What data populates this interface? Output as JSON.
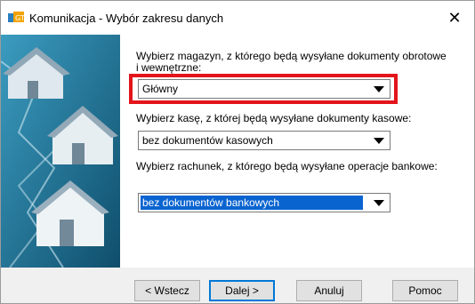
{
  "window": {
    "title": "Komunikacja - Wybór zakresu danych",
    "close_glyph": "✕"
  },
  "fields": [
    {
      "label": "Wybierz magazyn, z którego będą wysyłane dokumenty obrotowe i wewnętrzne:",
      "value": "Główny"
    },
    {
      "label": "Wybierz kasę, z której będą wysyłane dokumenty kasowe:",
      "value": "bez dokumentów kasowych"
    },
    {
      "label": "Wybierz rachunek, z którego będą wysyłane operacje bankowe:",
      "value": "bez dokumentów bankowych"
    }
  ],
  "buttons": {
    "back": "< Wstecz",
    "next": "Dalej >",
    "cancel": "Anuluj",
    "help": "Pomoc"
  },
  "colors": {
    "highlight": "#e3141b",
    "selection": "#0a64d0",
    "side_panel": "#1c6f8e"
  }
}
